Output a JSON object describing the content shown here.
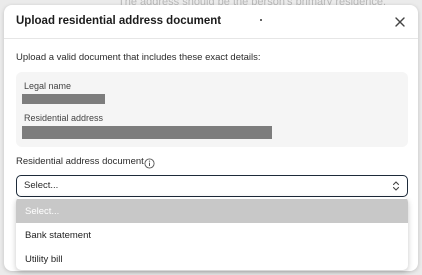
{
  "background": {
    "hint_text": "The address should be the person's primary residence."
  },
  "modal": {
    "title": "Upload residential address document",
    "intro": "Upload a valid document that includes these exact details:",
    "details": {
      "legal_name_label": "Legal name",
      "address_label": "Residential address"
    },
    "field_label": "Residential address document",
    "select": {
      "value": "Select...",
      "options": [
        "Select...",
        "Bank statement",
        "Utility bill"
      ],
      "selected_index": 0
    }
  },
  "icons": {
    "close": "close-icon",
    "info": "info-icon",
    "select_arrows": "chevron-up-down-icon"
  },
  "colors": {
    "focus_border": "#1e2b3a",
    "selected_option_bg": "#c8c8c8",
    "redaction": "#7d7d7d"
  }
}
